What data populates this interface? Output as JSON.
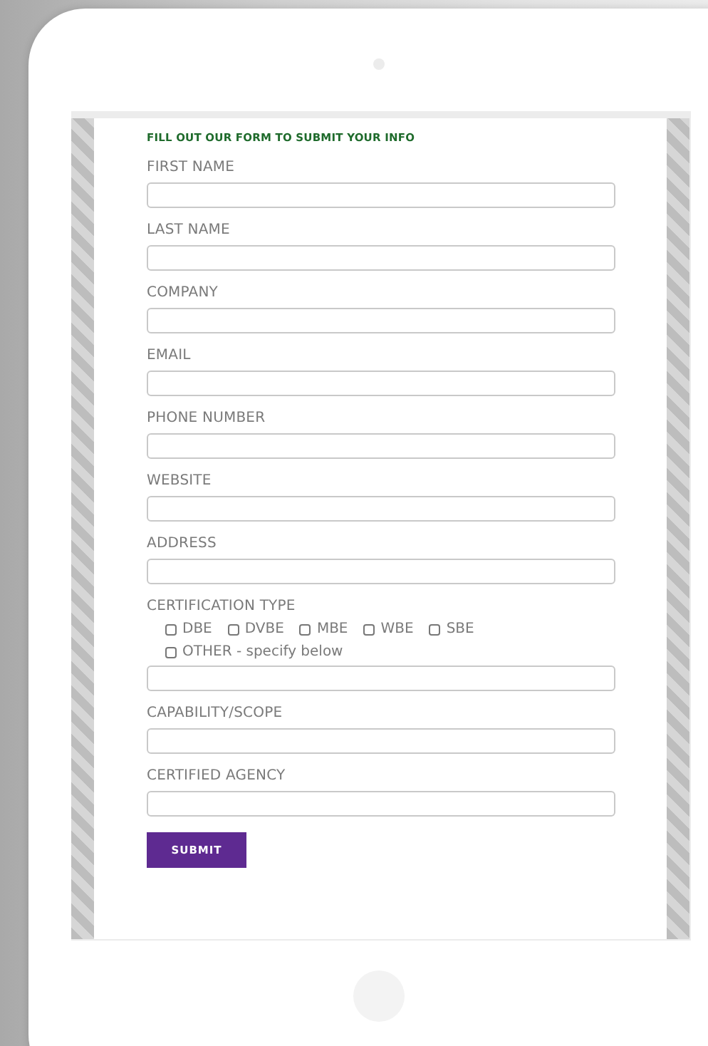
{
  "heading": "FILL OUT OUR FORM TO SUBMIT YOUR INFO",
  "fields": [
    {
      "kind": "text",
      "label": "FIRST NAME"
    },
    {
      "kind": "text",
      "label": "LAST NAME"
    },
    {
      "kind": "text",
      "label": "COMPANY"
    },
    {
      "kind": "text",
      "label": "EMAIL"
    },
    {
      "kind": "text",
      "label": "PHONE NUMBER"
    },
    {
      "kind": "text",
      "label": "WEBSITE"
    },
    {
      "kind": "text",
      "label": "ADDRESS"
    },
    {
      "kind": "checkboxes",
      "label": "CERTIFICATION TYPE",
      "options": [
        {
          "label": "DBE",
          "checked": false
        },
        {
          "label": "DVBE",
          "checked": false
        },
        {
          "label": "MBE",
          "checked": false
        },
        {
          "label": "WBE",
          "checked": false
        },
        {
          "label": "SBE",
          "checked": false
        },
        {
          "label": "OTHER - specify below",
          "checked": false
        }
      ]
    },
    {
      "kind": "text",
      "label": "CAPABILITY/SCOPE"
    },
    {
      "kind": "text",
      "label": "CERTIFIED AGENCY"
    }
  ],
  "submit": "SUBMIT"
}
